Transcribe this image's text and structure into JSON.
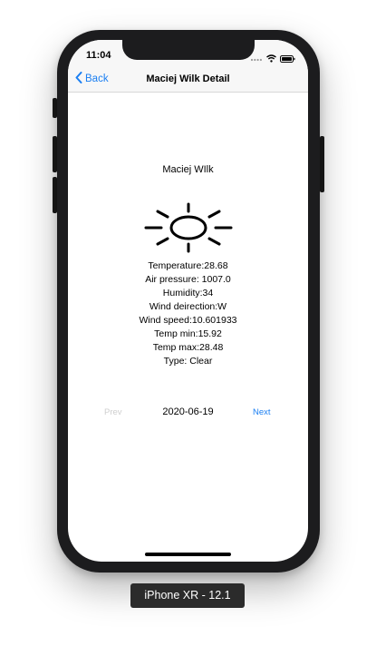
{
  "status_bar": {
    "time": "11:04"
  },
  "nav_bar": {
    "back_label": "Back",
    "title": "Maciej Wilk Detail"
  },
  "content": {
    "name": "Maciej WIlk",
    "weather_icon": "sun-icon",
    "details": [
      "Temperature:28.68",
      "Air pressure: 1007.0",
      "Humidity:34",
      "Wind deirection:W",
      "Wind speed:10.601933",
      "Temp min:15.92",
      "Temp max:28.48",
      "Type: Clear"
    ]
  },
  "pager": {
    "prev_label": "Prev",
    "date": "2020-06-19",
    "next_label": "Next"
  },
  "device": {
    "label": "iPhone XR - 12.1"
  },
  "colors": {
    "accent": "#1b7ff2",
    "disabled": "#cfcfcf",
    "bezel": "#1c1c1e"
  }
}
